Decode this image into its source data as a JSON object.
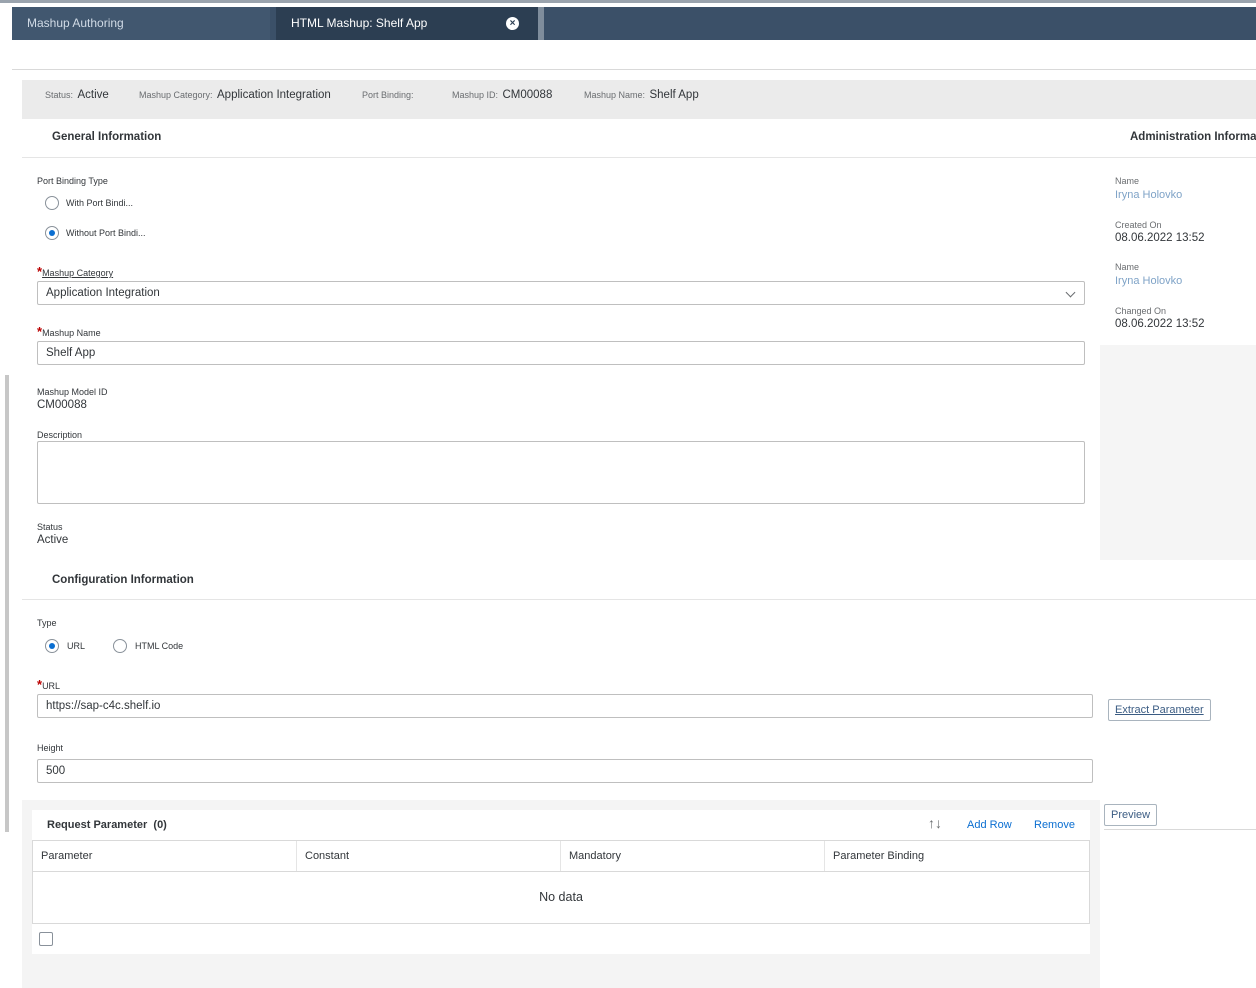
{
  "tabs": [
    {
      "label": "Mashup Authoring"
    },
    {
      "label": "HTML Mashup: Shelf App"
    }
  ],
  "header_facets": {
    "status_label": "Status:",
    "status_value": "Active",
    "category_label": "Mashup Category:",
    "category_value": "Application Integration",
    "port_binding_label": "Port Binding:",
    "id_label": "Mashup ID:",
    "id_value": "CM00088",
    "name_label": "Mashup Name:",
    "name_value": "Shelf App"
  },
  "general": {
    "title": "General Information",
    "port_binding_type_label": "Port Binding Type",
    "radio_with": "With Port Bindi...",
    "radio_without": "Without Port Bindi...",
    "selected_port_binding": "without",
    "category_label": "Mashup Category",
    "category_value": "Application Integration",
    "name_label": "Mashup Name",
    "name_value": "Shelf App",
    "model_id_label": "Mashup Model ID",
    "model_id_value": "CM00088",
    "description_label": "Description",
    "description_value": "",
    "status_label": "Status",
    "status_value": "Active"
  },
  "admin": {
    "title": "Administration Informa",
    "created_by_label": "Name",
    "created_by_value": "Iryna Holovko",
    "created_on_label": "Created On",
    "created_on_value": "08.06.2022 13:52",
    "changed_by_label": "Name",
    "changed_by_value": "Iryna Holovko",
    "changed_on_label": "Changed On",
    "changed_on_value": "08.06.2022 13:52"
  },
  "config": {
    "title": "Configuration Information",
    "type_label": "Type",
    "type_url": "URL",
    "type_html": "HTML Code",
    "selected_type": "url",
    "url_label": "URL",
    "url_value": "https://sap-c4c.shelf.io",
    "extract_button": "Extract Parameter",
    "height_label": "Height",
    "height_value": "500",
    "preview_button": "Preview"
  },
  "request_table": {
    "title": "Request Parameter",
    "count": "(0)",
    "add_row": "Add Row",
    "remove": "Remove",
    "columns": [
      "Parameter",
      "Constant",
      "Mandatory",
      "Parameter Binding"
    ],
    "empty_text": "No data"
  },
  "colors": {
    "tabbar": "#3b5068",
    "required": "#bb0000",
    "link": "#0a6ed1"
  }
}
